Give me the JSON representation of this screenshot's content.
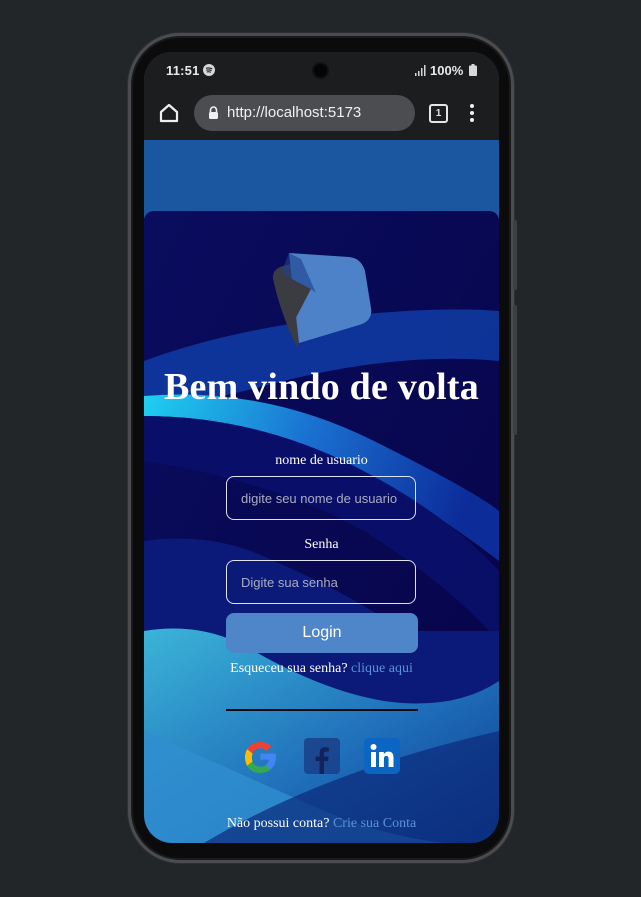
{
  "status": {
    "time": "11:51",
    "battery": "100%"
  },
  "browser": {
    "url": "http://localhost:5173",
    "tab_count": "1"
  },
  "login": {
    "title": "Bem vindo de volta",
    "username_label": "nome de usuario",
    "username_placeholder": "digite seu nome de usuario",
    "password_label": "Senha",
    "password_placeholder": "Digite sua senha",
    "login_button": "Login",
    "forgot_text": "Esqueceu sua senha?",
    "forgot_link": "clique aqui",
    "signup_text": "Não possui conta?",
    "signup_link": "Crie sua Conta"
  },
  "social": [
    {
      "icon": "google-icon"
    },
    {
      "icon": "facebook-icon"
    },
    {
      "icon": "linkedin-icon"
    }
  ],
  "colors": {
    "accent": "#4f86c9",
    "link": "#5b93d8",
    "page_background": "#1b56a0",
    "card_background": "#07075a",
    "frame_background": "#222629"
  }
}
